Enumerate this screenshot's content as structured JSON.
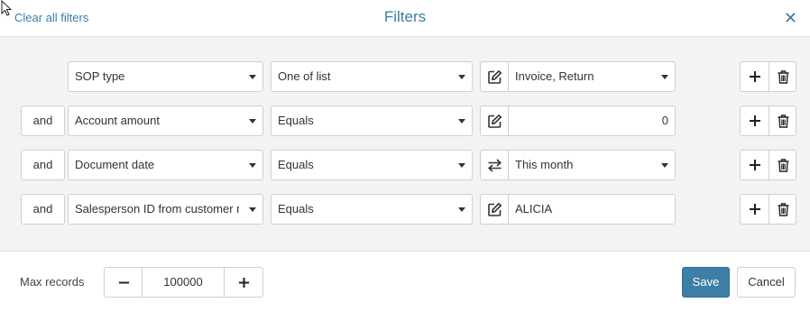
{
  "header": {
    "clear_link": "Clear all filters",
    "title": "Filters",
    "close_icon": "close-icon"
  },
  "filters": [
    {
      "conjunction": "",
      "field": "SOP type",
      "operator": "One of list",
      "mode_icon": "edit-icon",
      "value": "Invoice, Return",
      "value_type": "dropdown"
    },
    {
      "conjunction": "and",
      "field": "Account amount",
      "operator": "Equals",
      "mode_icon": "edit-icon",
      "value": "0",
      "value_type": "number"
    },
    {
      "conjunction": "and",
      "field": "Document date",
      "operator": "Equals",
      "mode_icon": "swap-icon",
      "value": "This month",
      "value_type": "dropdown"
    },
    {
      "conjunction": "and",
      "field": "Salesperson ID from customer m",
      "operator": "Equals",
      "mode_icon": "edit-icon",
      "value": "ALICIA",
      "value_type": "text"
    }
  ],
  "footer": {
    "max_records_label": "Max records",
    "max_records_value": "100000",
    "save_label": "Save",
    "cancel_label": "Cancel"
  },
  "colors": {
    "accent": "#3a7ca5",
    "save_bg": "#3d7fa6",
    "panel_bg": "#f3f3f3"
  }
}
